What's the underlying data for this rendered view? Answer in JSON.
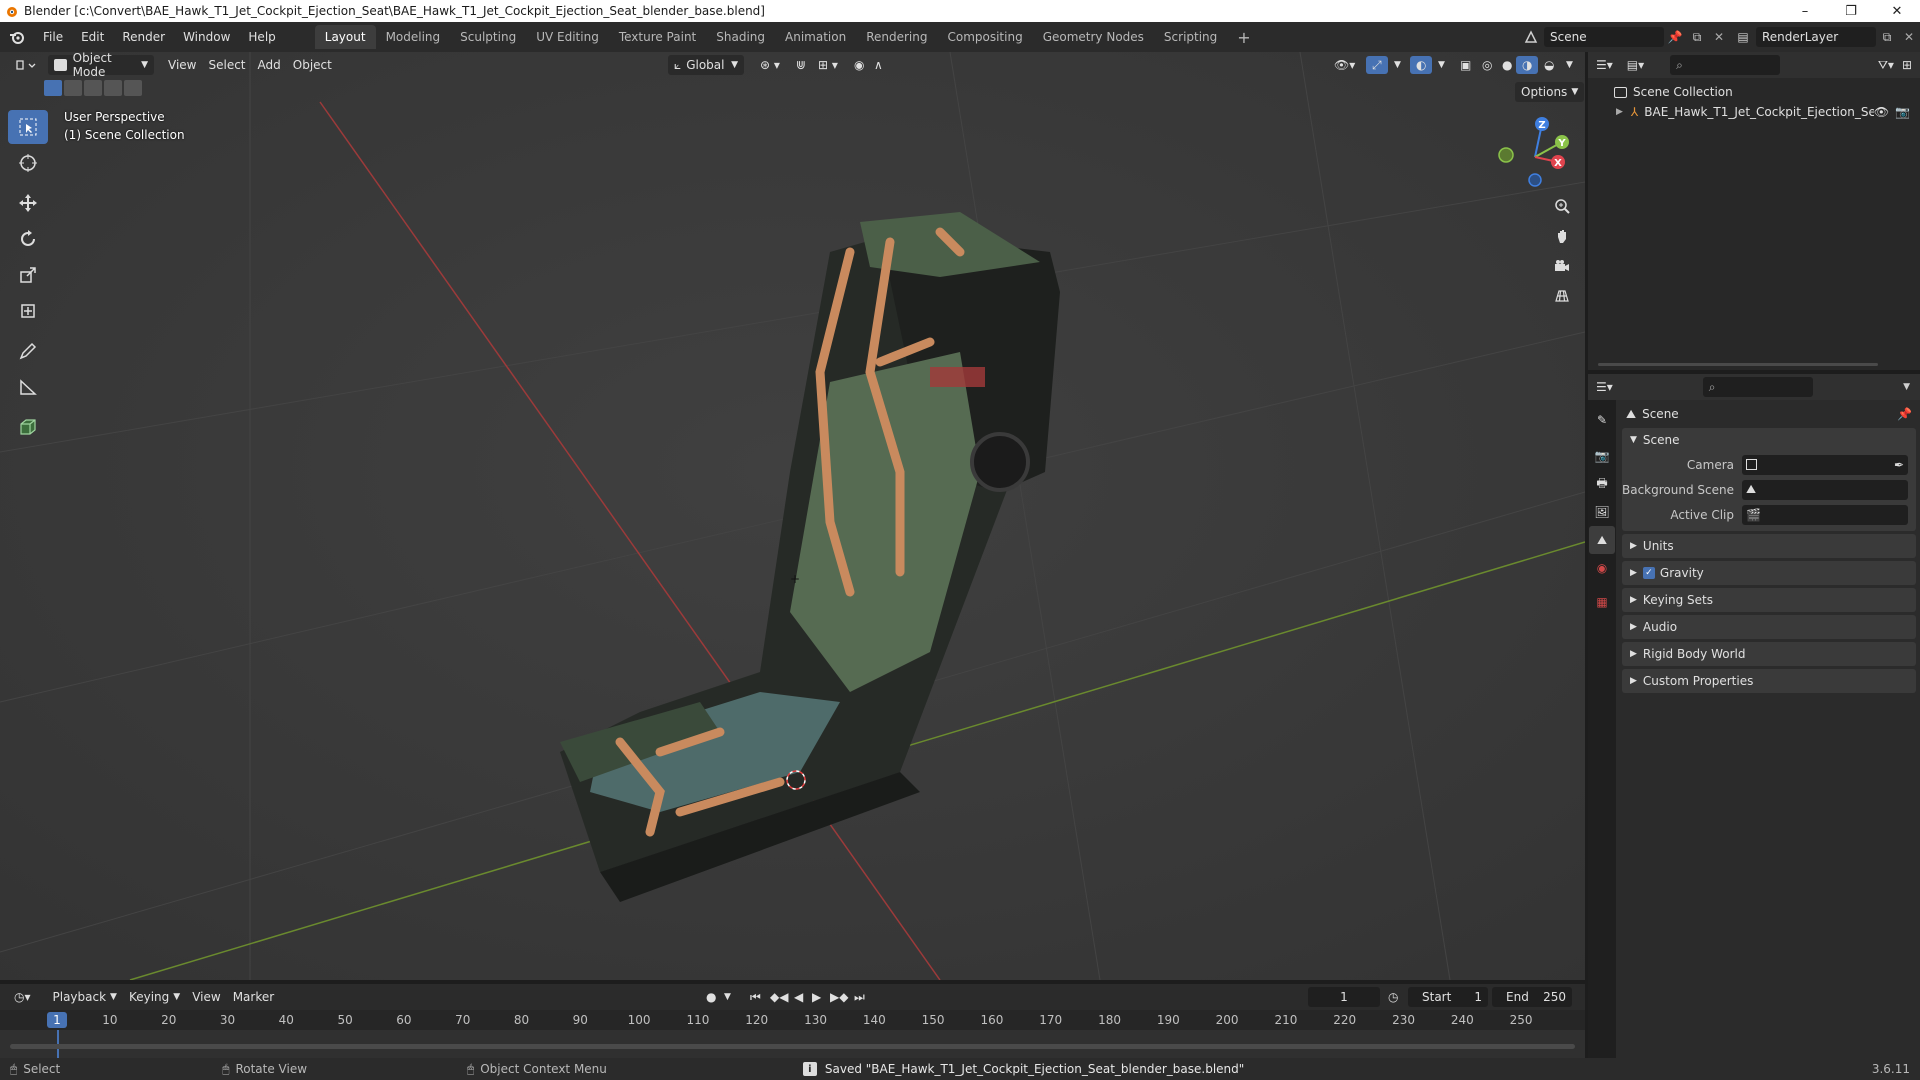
{
  "window": {
    "title": "Blender [c:\\Convert\\BAE_Hawk_T1_Jet_Cockpit_Ejection_Seat\\BAE_Hawk_T1_Jet_Cockpit_Ejection_Seat_blender_base.blend]",
    "minimize": "–",
    "maximize": "❐",
    "close": "✕"
  },
  "menu": {
    "items": [
      "File",
      "Edit",
      "Render",
      "Window",
      "Help"
    ],
    "workspaces": [
      "Layout",
      "Modeling",
      "Sculpting",
      "UV Editing",
      "Texture Paint",
      "Shading",
      "Animation",
      "Rendering",
      "Compositing",
      "Geometry Nodes",
      "Scripting"
    ],
    "active_workspace": "Layout",
    "add_workspace": "+",
    "scene": "Scene",
    "render_layer": "RenderLayer"
  },
  "viewport": {
    "mode": "Object Mode",
    "menus": [
      "View",
      "Select",
      "Add",
      "Object"
    ],
    "orientation": "Global",
    "options_label": "Options",
    "perspective_label": "User Perspective",
    "collection_label": "(1) Scene Collection",
    "gizmo": {
      "x": "X",
      "y": "Y",
      "z": "Z"
    }
  },
  "outliner": {
    "root": "Scene Collection",
    "items": [
      {
        "name": "BAE_Hawk_T1_Jet_Cockpit_Ejection_Se"
      }
    ]
  },
  "properties": {
    "context_title": "Scene",
    "scene_panel": {
      "title": "Scene",
      "rows": [
        {
          "label": "Camera",
          "value": ""
        },
        {
          "label": "Background Scene",
          "value": ""
        },
        {
          "label": "Active Clip",
          "value": ""
        }
      ]
    },
    "collapsed_panels": [
      "Units",
      "Gravity",
      "Keying Sets",
      "Audio",
      "Rigid Body World",
      "Custom Properties"
    ],
    "gravity_checked": true
  },
  "timeline": {
    "menus": [
      "Playback",
      "Keying",
      "View",
      "Marker"
    ],
    "current_frame": "1",
    "start_label": "Start",
    "start_value": "1",
    "end_label": "End",
    "end_value": "250",
    "ticks": [
      "1",
      "10",
      "20",
      "30",
      "40",
      "50",
      "60",
      "70",
      "80",
      "90",
      "100",
      "110",
      "120",
      "130",
      "140",
      "150",
      "160",
      "170",
      "180",
      "190",
      "200",
      "210",
      "220",
      "230",
      "240",
      "250"
    ]
  },
  "status": {
    "select": "Select",
    "rotate": "Rotate View",
    "context_menu": "Object Context Menu",
    "message": "Saved \"BAE_Hawk_T1_Jet_Cockpit_Ejection_Seat_blender_base.blend\"",
    "version": "3.6.11"
  },
  "colors": {
    "accent": "#4772b3",
    "x_axis": "#e0444e",
    "y_axis": "#8bc34a",
    "z_axis": "#3f7fe0"
  }
}
